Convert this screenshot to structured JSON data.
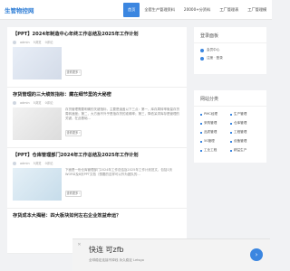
{
  "header": {
    "logo": "生管物控网",
    "nav": [
      "首页",
      "全套生产管理资料",
      "20000+分资料",
      "工厂管理表",
      "工厂管理模"
    ]
  },
  "articles": [
    {
      "title": "【PPT】2024年制造中心年终工作总结及2025年工作计划",
      "author": "admin",
      "views": "5浏览",
      "comments": "0评论",
      "excerpt": "",
      "button": "查看更多 ›"
    },
    {
      "title": "存货管理的三大绩效指标：藏在细节里的大秘密",
      "author": "admin",
      "views": "5浏览",
      "comments": "0评论",
      "excerpt": "存货管理需要明确的关键指标，主要是涵盖以下三点：第一，库存周转率衡量存货周转速度；第二，大方面不外乎是指存货的准确率；第三，降低呆滞库存是管理的关键，在此基础...",
      "button": "查看更多 ›"
    },
    {
      "title": "【PPT】仓库管理部门2024年工作总结及2025年工作计划",
      "author": "admin",
      "views": "5浏览",
      "comments": "0评论",
      "excerpt": "下面是一份仓库管理部门2024年工作总结及2025年工作计划范文，包括1页WORD及8页PPT文档（想要的这样可以作为团队的...",
      "button": "查看更多 ›"
    },
    {
      "title": "存货成本大揭秘：四大板块如何左右企业效益命运？",
      "author": "",
      "views": "",
      "comments": "",
      "excerpt": "",
      "button": ""
    }
  ],
  "sidebar": {
    "login": {
      "title": "登录面板",
      "rows": [
        "会员中心",
        "注册 · 登录"
      ]
    },
    "categories": {
      "title": "网站分类",
      "items": [
        "PMC经理",
        "生产管理",
        "采购管理",
        "仓库管理",
        "品质管理",
        "工程管理",
        "5S管理",
        "设备管理",
        "工业工程",
        "精益生产"
      ]
    }
  },
  "ad": {
    "title": "快连 可zfb",
    "subtitle": "全球稳定连接不掉线 永久稳定 Letsgo",
    "close": "✕",
    "arrow": "›"
  },
  "colors": {
    "accent": "#3b86e0",
    "background": "#f1f2f4"
  }
}
